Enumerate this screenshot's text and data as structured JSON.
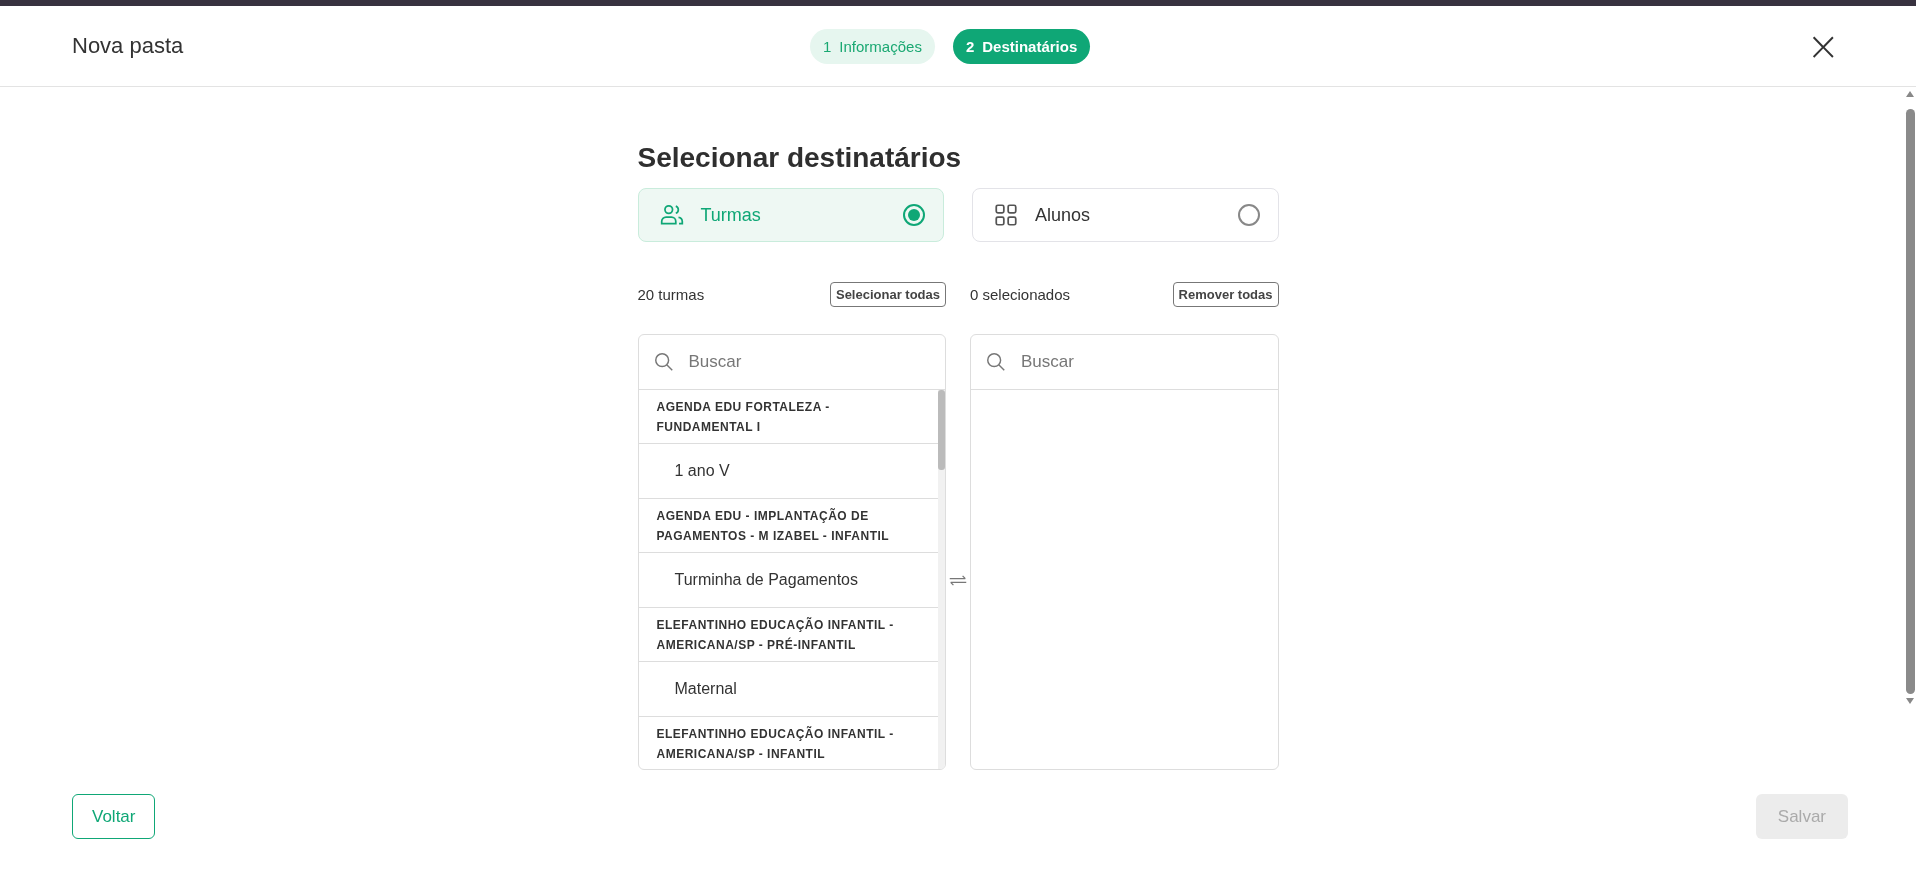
{
  "header": {
    "title": "Nova pasta",
    "close": "×"
  },
  "steps": [
    {
      "number": "1",
      "label": "Informações",
      "selected": false
    },
    {
      "number": "2",
      "label": "Destinatários",
      "selected": true
    }
  ],
  "heading": "Selecionar destinatários",
  "options": [
    {
      "kind": "groups",
      "label": "Turmas",
      "selected": true
    },
    {
      "kind": "grid",
      "label": "Alunos",
      "selected": false
    }
  ],
  "available": {
    "count": "20 turmas",
    "action": "Selecionar todas",
    "search": {
      "placeholder": "Buscar"
    },
    "groups": [
      {
        "name": "AGENDA EDU FORTALEZA - FUNDAMENTAL I",
        "children": [
          {
            "name": "1 ano V"
          }
        ]
      },
      {
        "name": "AGENDA EDU - IMPLANTAÇÃO DE PAGAMENTOS - M IZABEL - INFANTIL",
        "children": [
          {
            "name": "Turminha de Pagamentos"
          }
        ]
      },
      {
        "name": "ELEFANTINHO EDUCAÇÃO INFANTIL - AMERICANA/SP - PRÉ-INFANTIL",
        "children": [
          {
            "name": "Maternal"
          }
        ]
      },
      {
        "name": "ELEFANTINHO EDUCAÇÃO INFANTIL - AMERICANA/SP - INFANTIL"
      }
    ]
  },
  "selected": {
    "count": "0 selecionados",
    "action": "Remover todas",
    "search": {
      "placeholder": "Buscar"
    }
  },
  "footer": {
    "back": {
      "label": "Voltar",
      "disabled": false
    },
    "save": {
      "label": "Salvar",
      "disabled": true
    }
  }
}
